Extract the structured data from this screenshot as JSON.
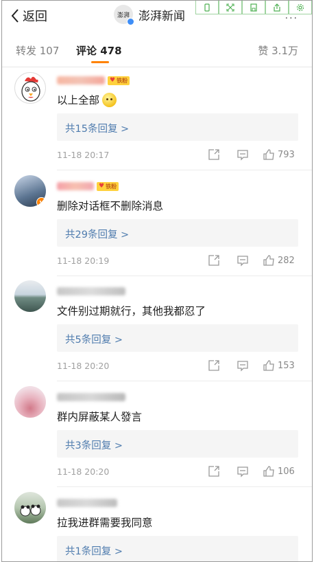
{
  "nav": {
    "back_label": "返回",
    "source_logo": "澎湃",
    "source_name": "澎湃新闻",
    "more_label": "···"
  },
  "toolbar_icons": [
    "phone-icon",
    "expand-icon",
    "save-icon",
    "share-out-icon",
    "settings-icon"
  ],
  "tabs": {
    "repost": "转发 107",
    "comment": "评论 478",
    "likes": "赞 3.1万"
  },
  "accent_color": "#ff8200",
  "link_color": "#4f7cae",
  "fan_badge_label": "铁粉",
  "comments": [
    {
      "text": "以上全部",
      "replies": "共15条回复 >",
      "time": "11-18 20:17",
      "likes": "793",
      "fan_badge": true,
      "has_emoji": true
    },
    {
      "text": "删除对话框不删除消息",
      "replies": "共29条回复 >",
      "time": "11-18 20:19",
      "likes": "282",
      "fan_badge": true,
      "verified": true
    },
    {
      "text": "文件别过期就行，其他我都忍了",
      "replies": "共5条回复 >",
      "time": "11-18 20:20",
      "likes": "153"
    },
    {
      "text": "群内屏蔽某人發言",
      "replies": "共3条回复 >",
      "time": "11-18 20:20",
      "likes": "106"
    },
    {
      "text": "拉我进群需要我同意",
      "replies": "共1条回复 >"
    }
  ]
}
